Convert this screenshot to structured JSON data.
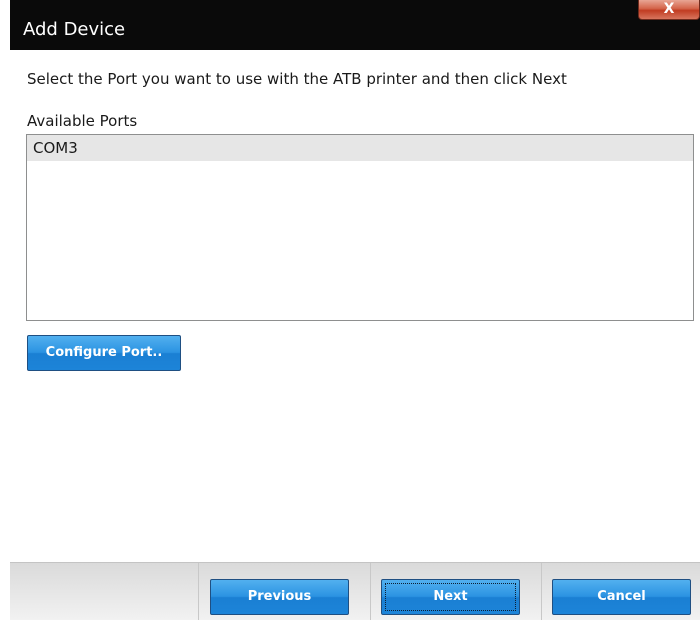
{
  "window": {
    "title": "Add Device",
    "close_label": "X"
  },
  "main": {
    "instruction": "Select the Port you want to use with the ATB printer and then click Next",
    "ports_label": "Available Ports",
    "ports": [
      {
        "name": "COM3",
        "selected": true
      }
    ],
    "configure_label": "Configure Port.."
  },
  "footer": {
    "previous_label": "Previous",
    "next_label": "Next",
    "cancel_label": "Cancel"
  },
  "colors": {
    "titlebar": "#0a0a0a",
    "button_blue": "#2b93e2",
    "close_red": "#c13c22",
    "selected_row": "#e6e6e6"
  }
}
